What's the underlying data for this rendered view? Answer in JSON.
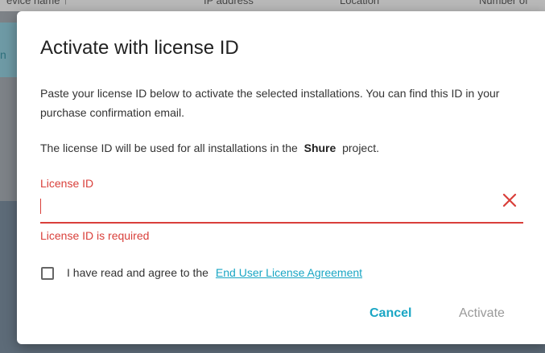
{
  "background": {
    "columns": [
      "evice name ↑",
      "IP address",
      "Location",
      "Number of"
    ],
    "band_text": "n"
  },
  "dialog": {
    "title": "Activate with license ID",
    "description": "Paste your license ID below to activate the selected installations. You can find this ID in your purchase confirmation email.",
    "info_prefix": "The license ID will be used for all installations in the",
    "project_name": "Shure",
    "info_suffix": "project.",
    "license_field": {
      "label": "License ID",
      "value": "",
      "error": "License ID is required",
      "clear_icon": "close-icon"
    },
    "agreement": {
      "checked": false,
      "text": "I have read and agree to the",
      "link": "End User License Agreement"
    },
    "buttons": {
      "cancel": "Cancel",
      "activate": "Activate"
    }
  },
  "colors": {
    "error": "#d93f3a",
    "accent": "#1aa6c4",
    "disabled": "#9a9a9a"
  }
}
